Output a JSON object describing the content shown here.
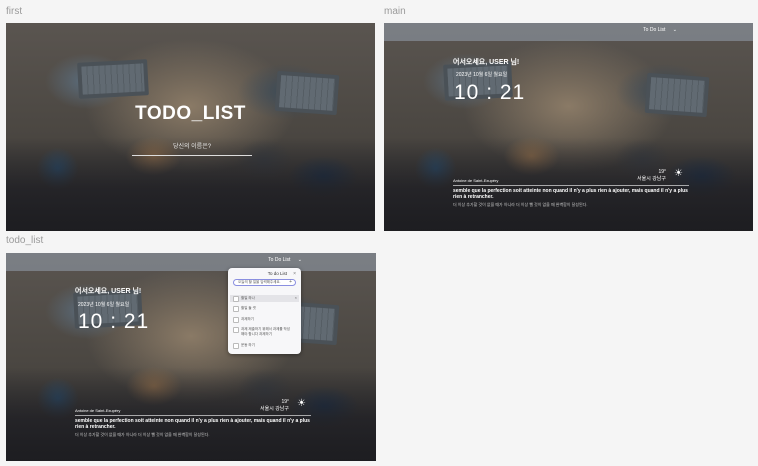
{
  "labels": {
    "first": "first",
    "main": "main",
    "todo_list": "todo_list"
  },
  "first": {
    "title": "TODO_LIST",
    "name_placeholder": "당신의 이름은?"
  },
  "common": {
    "todo_button": "To Do List",
    "todo_button_chevron": "⌄",
    "greeting": "어서오세요, USER 님!",
    "date": "2023년 10월 6일 월요일",
    "time": "10 : 21",
    "temperature": "19°",
    "location": "서울시 강남구",
    "weather_icon": "sun-icon",
    "quote_author": "Antoine de Saint-Exupéry",
    "quote_text": "semble que la perfection soit atteinte non quand il n'y a plus rien à ajouter, mais quand il n'y a plus rien à retrancher.",
    "quote_translation": "더 이상 추가할 것이 없을 때가 아니라 더 이상 뺄 것이 없을 때 완벽함이 달성된다."
  },
  "todo_panel": {
    "title": "To do List",
    "close": "×",
    "input_placeholder": "오늘의 할 일을 입력해주세요.",
    "add": "+",
    "items": [
      {
        "text": "할일 하나",
        "selected": true
      },
      {
        "text": "할일 둘 셋",
        "selected": false
      },
      {
        "text": "과제하기",
        "selected": false
      },
      {
        "text": "과제 제출하기 위해서 과제를 작성해야 합니다 과제하기",
        "selected": false
      },
      {
        "text": "운동 하기",
        "selected": false
      }
    ],
    "delete": "×"
  }
}
